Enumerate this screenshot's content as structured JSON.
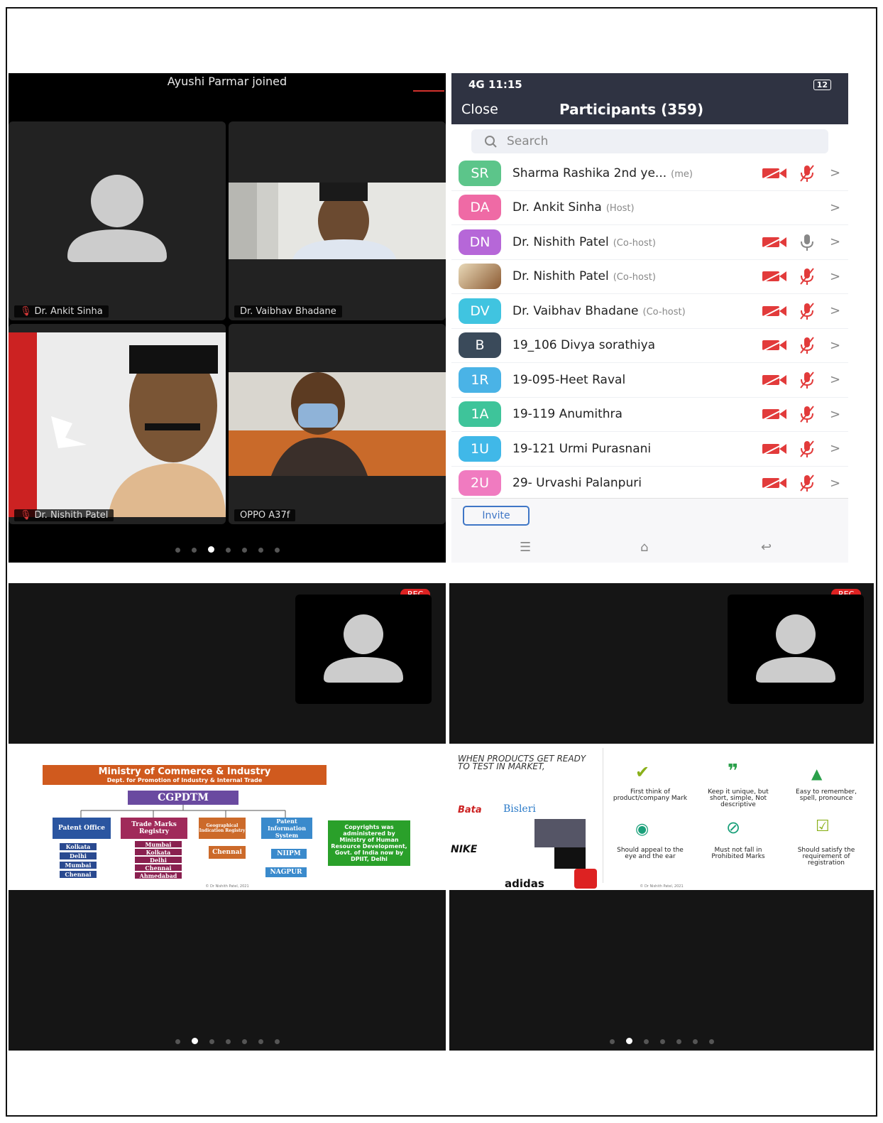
{
  "meeting": {
    "toast": "Ayushi Parmar joined",
    "tiles": [
      {
        "name": "Dr. Ankit Sinha",
        "muted": true
      },
      {
        "name": "Dr. Vaibhav Bhadane",
        "muted": false
      },
      {
        "name": "Dr. Nishith Patel",
        "muted": true
      },
      {
        "name": "OPPO A37f",
        "muted": false
      }
    ],
    "active_page": 3,
    "page_count": 7
  },
  "participants_screen": {
    "status": {
      "left": "4G 11:15",
      "right": "12"
    },
    "close_label": "Close",
    "title": "Participants (359)",
    "search_placeholder": "Search",
    "rows": [
      {
        "initials": "SR",
        "color": "#5cc58a",
        "name": "Sharma Rashika 2nd ye...",
        "role": "(me)",
        "cam": true,
        "mic": "muted"
      },
      {
        "initials": "DA",
        "color": "#ef6aa5",
        "name": "Dr. Ankit Sinha",
        "role": "(Host)",
        "cam": false,
        "mic": "none"
      },
      {
        "initials": "DN",
        "color": "#b667d8",
        "name": "Dr. Nishith Patel",
        "role": "(Co-host)",
        "cam": true,
        "mic": "on"
      },
      {
        "initials": "",
        "color": "#c8a070",
        "name": "Dr. Nishith Patel",
        "role": "(Co-host)",
        "cam": true,
        "mic": "muted"
      },
      {
        "initials": "DV",
        "color": "#40c4e0",
        "name": "Dr. Vaibhav Bhadane",
        "role": "(Co-host)",
        "cam": true,
        "mic": "muted"
      },
      {
        "initials": "B",
        "color": "#3a4a5a",
        "name": "19_106 Divya sorathiya",
        "role": "",
        "cam": true,
        "mic": "muted"
      },
      {
        "initials": "1R",
        "color": "#4ab3e6",
        "name": "19-095-Heet Raval",
        "role": "",
        "cam": true,
        "mic": "muted"
      },
      {
        "initials": "1A",
        "color": "#3ec49a",
        "name": "19-119 Anumithra",
        "role": "",
        "cam": true,
        "mic": "muted"
      },
      {
        "initials": "1U",
        "color": "#40b8e8",
        "name": "19-121 Urmi Purasnani",
        "role": "",
        "cam": true,
        "mic": "muted"
      },
      {
        "initials": "2U",
        "color": "#f07bc0",
        "name": "29- Urvashi Palanpuri",
        "role": "",
        "cam": true,
        "mic": "muted"
      }
    ],
    "invite_label": "Invite"
  },
  "slide1": {
    "rec": "REC",
    "ministry": "Ministry of Commerce & Industry",
    "dept": "Dept. for Promotion of Industry & Internal Trade",
    "cgpdtm": "CGPDTM",
    "patent_office": "Patent Office",
    "patent_cities": [
      "Kolkata",
      "Delhi",
      "Mumbai",
      "Chennai"
    ],
    "trademarks": "Trade Marks Registry",
    "tm_cities": [
      "Mumbai",
      "Kolkata",
      "Delhi",
      "Chennai",
      "Ahmedabad"
    ],
    "gi": "Geographical Indication Registry",
    "gi_city": "Chennai",
    "pis": "Patent Information System",
    "niipm": "NIIPM",
    "nagpur": "NAGPUR",
    "copyright": "Copyrights was administered by Ministry of Human Resource Development, Govt. of India now by DPIIT, Delhi",
    "footer": "© Dr Nishith Patel, 2021"
  },
  "slide2": {
    "rec": "REC",
    "heading": "WHEN PRODUCTS GET READY TO TEST IN MARKET,",
    "brands": [
      "Bata",
      "Bisleri",
      "NIKE",
      "adidas"
    ],
    "tips": [
      "First think of product/company Mark",
      "Keep it unique, but short, simple, Not descriptive",
      "Easy to remember, spell, pronounce",
      "Should appeal to the eye and the ear",
      "Must not fall in Prohibited Marks",
      "Should satisfy the requirement of registration"
    ],
    "footer": "© Dr Nishith Patel, 2021"
  },
  "colors": {
    "zoom_dark": "#2f3342",
    "rec": "#dd2222",
    "muted_red": "#e23b3b",
    "ministry_orange": "#d05a1e",
    "cgpdtm_purple": "#6a4aa0"
  }
}
